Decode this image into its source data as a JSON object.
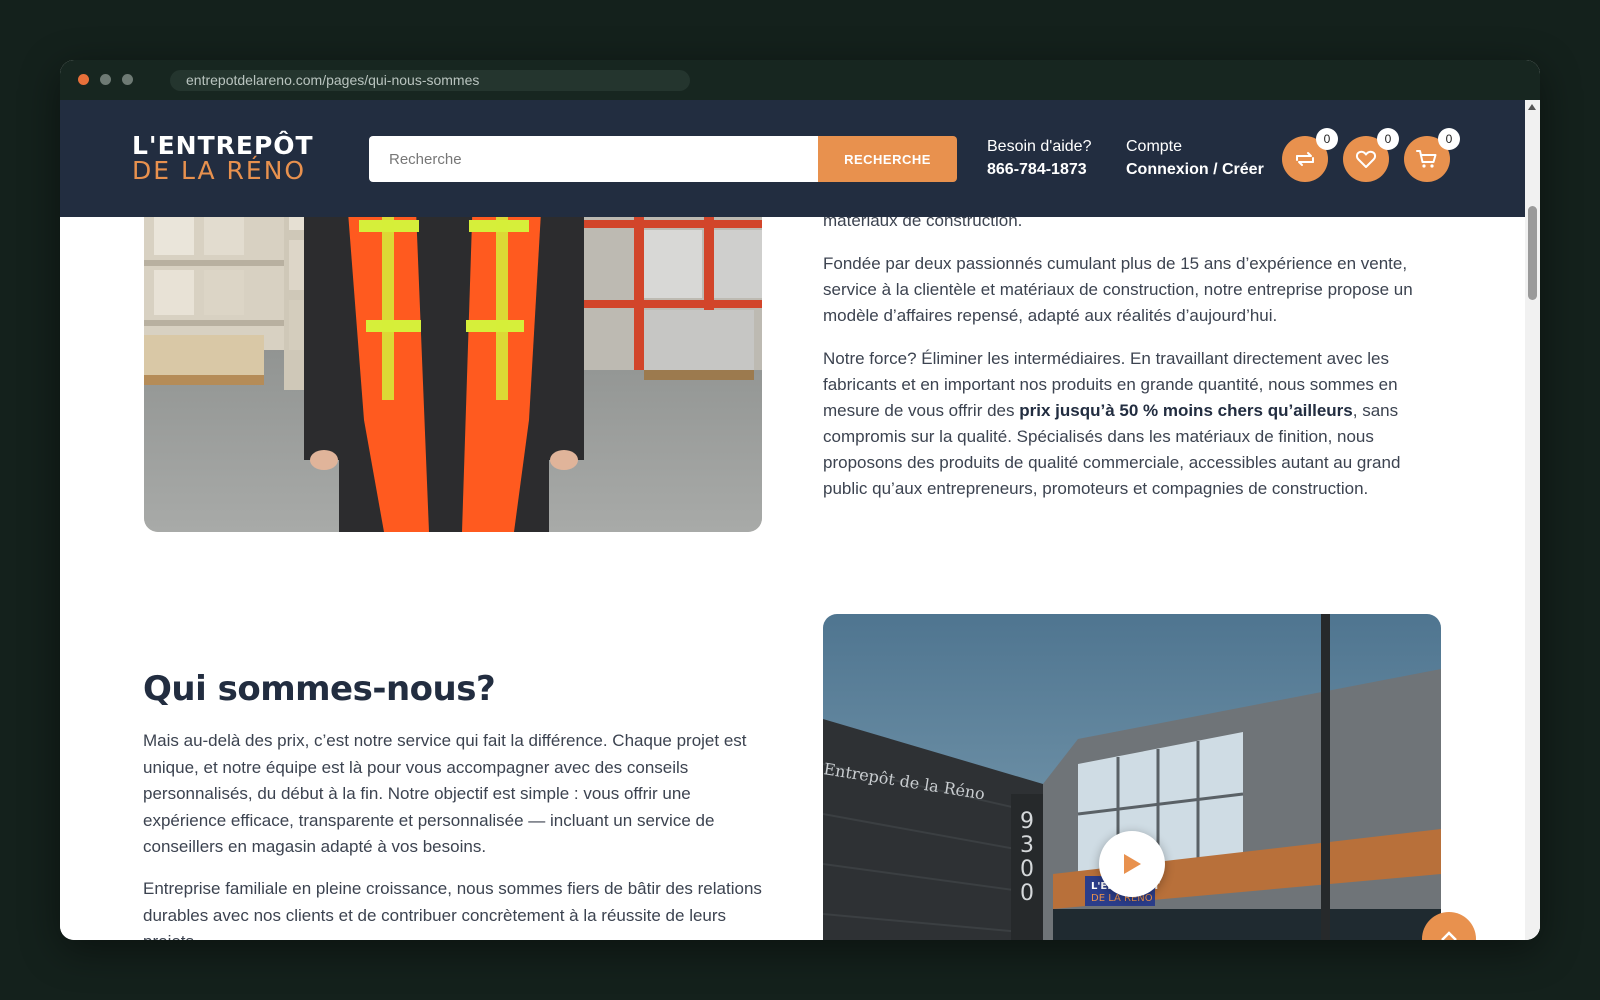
{
  "browser": {
    "url": "entrepotdelareno.com/pages/qui-nous-sommes"
  },
  "header": {
    "logo_line1": "L'ENTREPÔT",
    "logo_line2": "DE LA RÉNO",
    "search": {
      "placeholder": "Recherche",
      "button_label": "RECHERCHE"
    },
    "help": {
      "label": "Besoin d'aide?",
      "phone": "866-784-1873"
    },
    "account": {
      "label": "Compte",
      "action": "Connexion / Créer"
    },
    "compare": {
      "icon": "compare-arrows-icon",
      "count": "0"
    },
    "wishlist": {
      "icon": "heart-icon",
      "count": "0"
    },
    "cart": {
      "icon": "cart-icon",
      "count": "0"
    }
  },
  "about": {
    "cutoff_tail": "matériaux de construction.",
    "paragraph1": "Fondée par deux passionnés cumulant plus de 15 ans d’expérience en vente, service à la clientèle et matériaux de construction, notre entreprise propose un modèle d’affaires repensé, adapté aux réalités d’aujourd’hui.",
    "paragraph2_before": "Notre force? Éliminer les intermédiaires. En travaillant directement avec les fabricants et en important nos produits en grande quantité, nous sommes en mesure de vous offrir des ",
    "paragraph2_bold": "prix jusqu’à 50 % moins chers qu’ailleurs",
    "paragraph2_after": ", sans compromis sur la qualité. Spécialisés dans les matériaux de finition, nous proposons des produits de qualité commerciale, accessibles autant au grand public qu’aux entrepreneurs, promoteurs et compagnies de construction."
  },
  "who": {
    "title": "Qui sommes-nous?",
    "paragraph1": "Mais au-delà des prix, c’est notre service qui fait la différence. Chaque projet est unique, et notre équipe est là pour vous accompagner avec des conseils personnalisés, du début à la fin. Notre objectif est simple : vous offrir une expérience efficace, transparente et personnalisée — incluant un service de conseillers en magasin adapté à vos besoins.",
    "paragraph2": "Entreprise familiale en pleine croissance, nous sommes fiers de bâtir des relations durables avec nos clients et de contribuer concrètement à la réussite de leurs projets."
  },
  "building_photo": {
    "sign_text": "Entrepôt de la Réno",
    "street_number": [
      "9",
      "3",
      "0",
      "0"
    ],
    "storefront_line1": "L'ENTREPÔT",
    "storefront_line2": "DE LA RÉNO"
  },
  "colors": {
    "header_bg": "#222d40",
    "accent": "#e8914e",
    "heading": "#222d40",
    "body_text": "#3c4350"
  }
}
